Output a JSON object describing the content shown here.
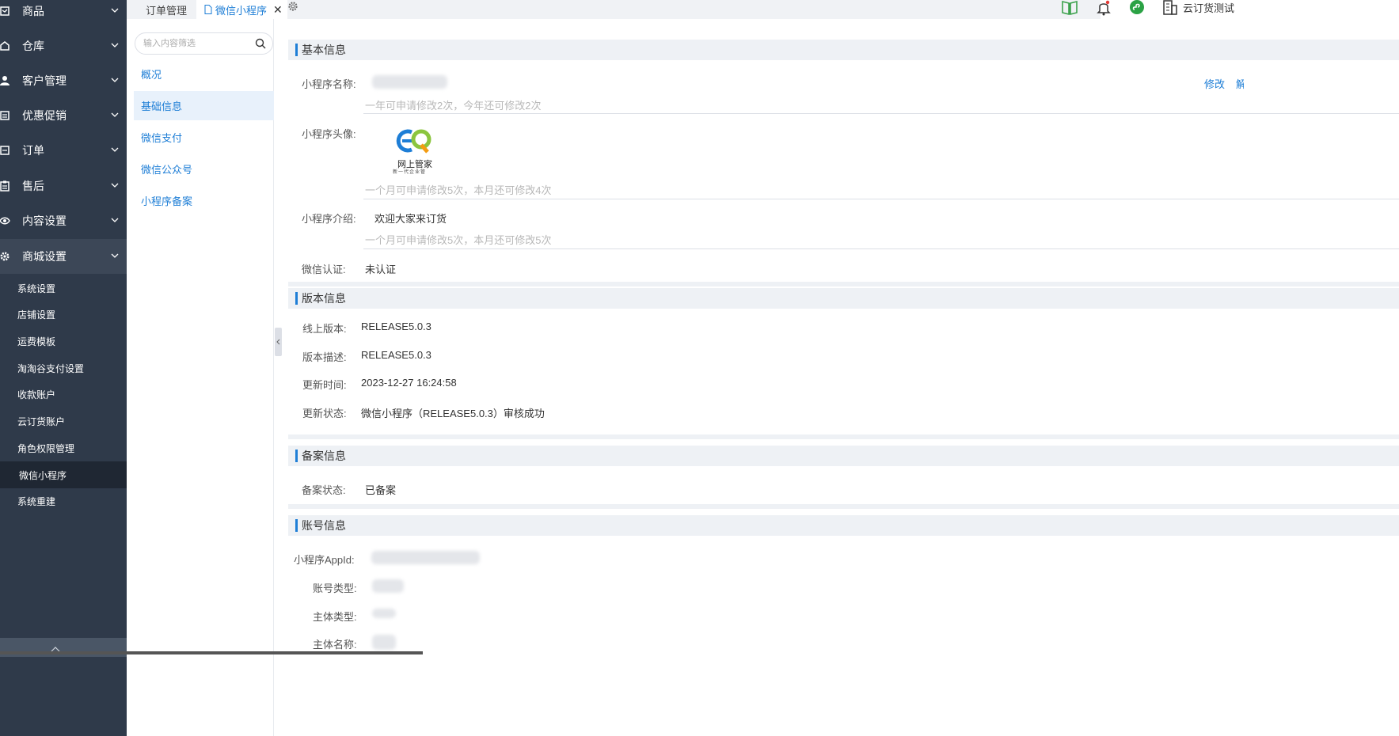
{
  "sidebar": {
    "menu": [
      {
        "label": "商品",
        "icon": "box-icon"
      },
      {
        "label": "仓库",
        "icon": "warehouse-icon"
      },
      {
        "label": "客户管理",
        "icon": "user-icon"
      },
      {
        "label": "优惠促销",
        "icon": "coupon-icon"
      },
      {
        "label": "订单",
        "icon": "order-icon"
      },
      {
        "label": "售后",
        "icon": "clipboard-icon"
      },
      {
        "label": "内容设置",
        "icon": "eye-icon"
      },
      {
        "label": "商城设置",
        "icon": "gear-icon"
      }
    ],
    "submenu": [
      "系统设置",
      "店铺设置",
      "运费模板",
      "淘淘谷支付设置",
      "收款账户",
      "云订货账户",
      "角色权限管理",
      "微信小程序",
      "系统重建"
    ],
    "active_submenu": "微信小程序"
  },
  "topbar": {
    "tabs": [
      {
        "label": "订单管理",
        "active": false
      },
      {
        "label": "微信小程序",
        "active": true,
        "close": "✕"
      }
    ],
    "user_name": "云订货测试"
  },
  "subnav": {
    "search_placeholder": "输入内容筛选",
    "items": [
      "概况",
      "基础信息",
      "微信支付",
      "微信公众号",
      "小程序备案"
    ],
    "active": "基础信息"
  },
  "main": {
    "basic": {
      "title": "基本信息",
      "name_label": "小程序名称:",
      "name_hint": "一年可申请修改2次，今年还可修改2次",
      "edit_label": "修改",
      "edit_label_2": "解",
      "avatar_label": "小程序头像:",
      "avatar_text": "网上管家",
      "avatar_sub": "新一代企业管",
      "avatar_hint": "一个月可申请修改5次，本月还可修改4次",
      "intro_label": "小程序介绍:",
      "intro_value": "欢迎大家来订货",
      "intro_hint": "一个月可申请修改5次，本月还可修改5次",
      "cert_label": "微信认证:",
      "cert_value": "未认证"
    },
    "version": {
      "title": "版本信息",
      "online_label": "线上版本:",
      "online_value": "RELEASE5.0.3",
      "desc_label": "版本描述:",
      "desc_value": "RELEASE5.0.3",
      "time_label": "更新时间:",
      "time_value": "2023-12-27 16:24:58",
      "status_label": "更新状态:",
      "status_value": "微信小程序（RELEASE5.0.3）审核成功"
    },
    "filing": {
      "title": "备案信息",
      "status_label": "备案状态:",
      "status_value": "已备案"
    },
    "account": {
      "title": "账号信息",
      "appid_label": "小程序AppId:",
      "type_label": "账号类型:",
      "subject_type_label": "主体类型:",
      "subject_name_label": "主体名称:"
    }
  },
  "colors": {
    "sidebar_bg": "#2f3a4a",
    "accent": "#1e7ed6",
    "section_bg": "#eef1f5"
  }
}
